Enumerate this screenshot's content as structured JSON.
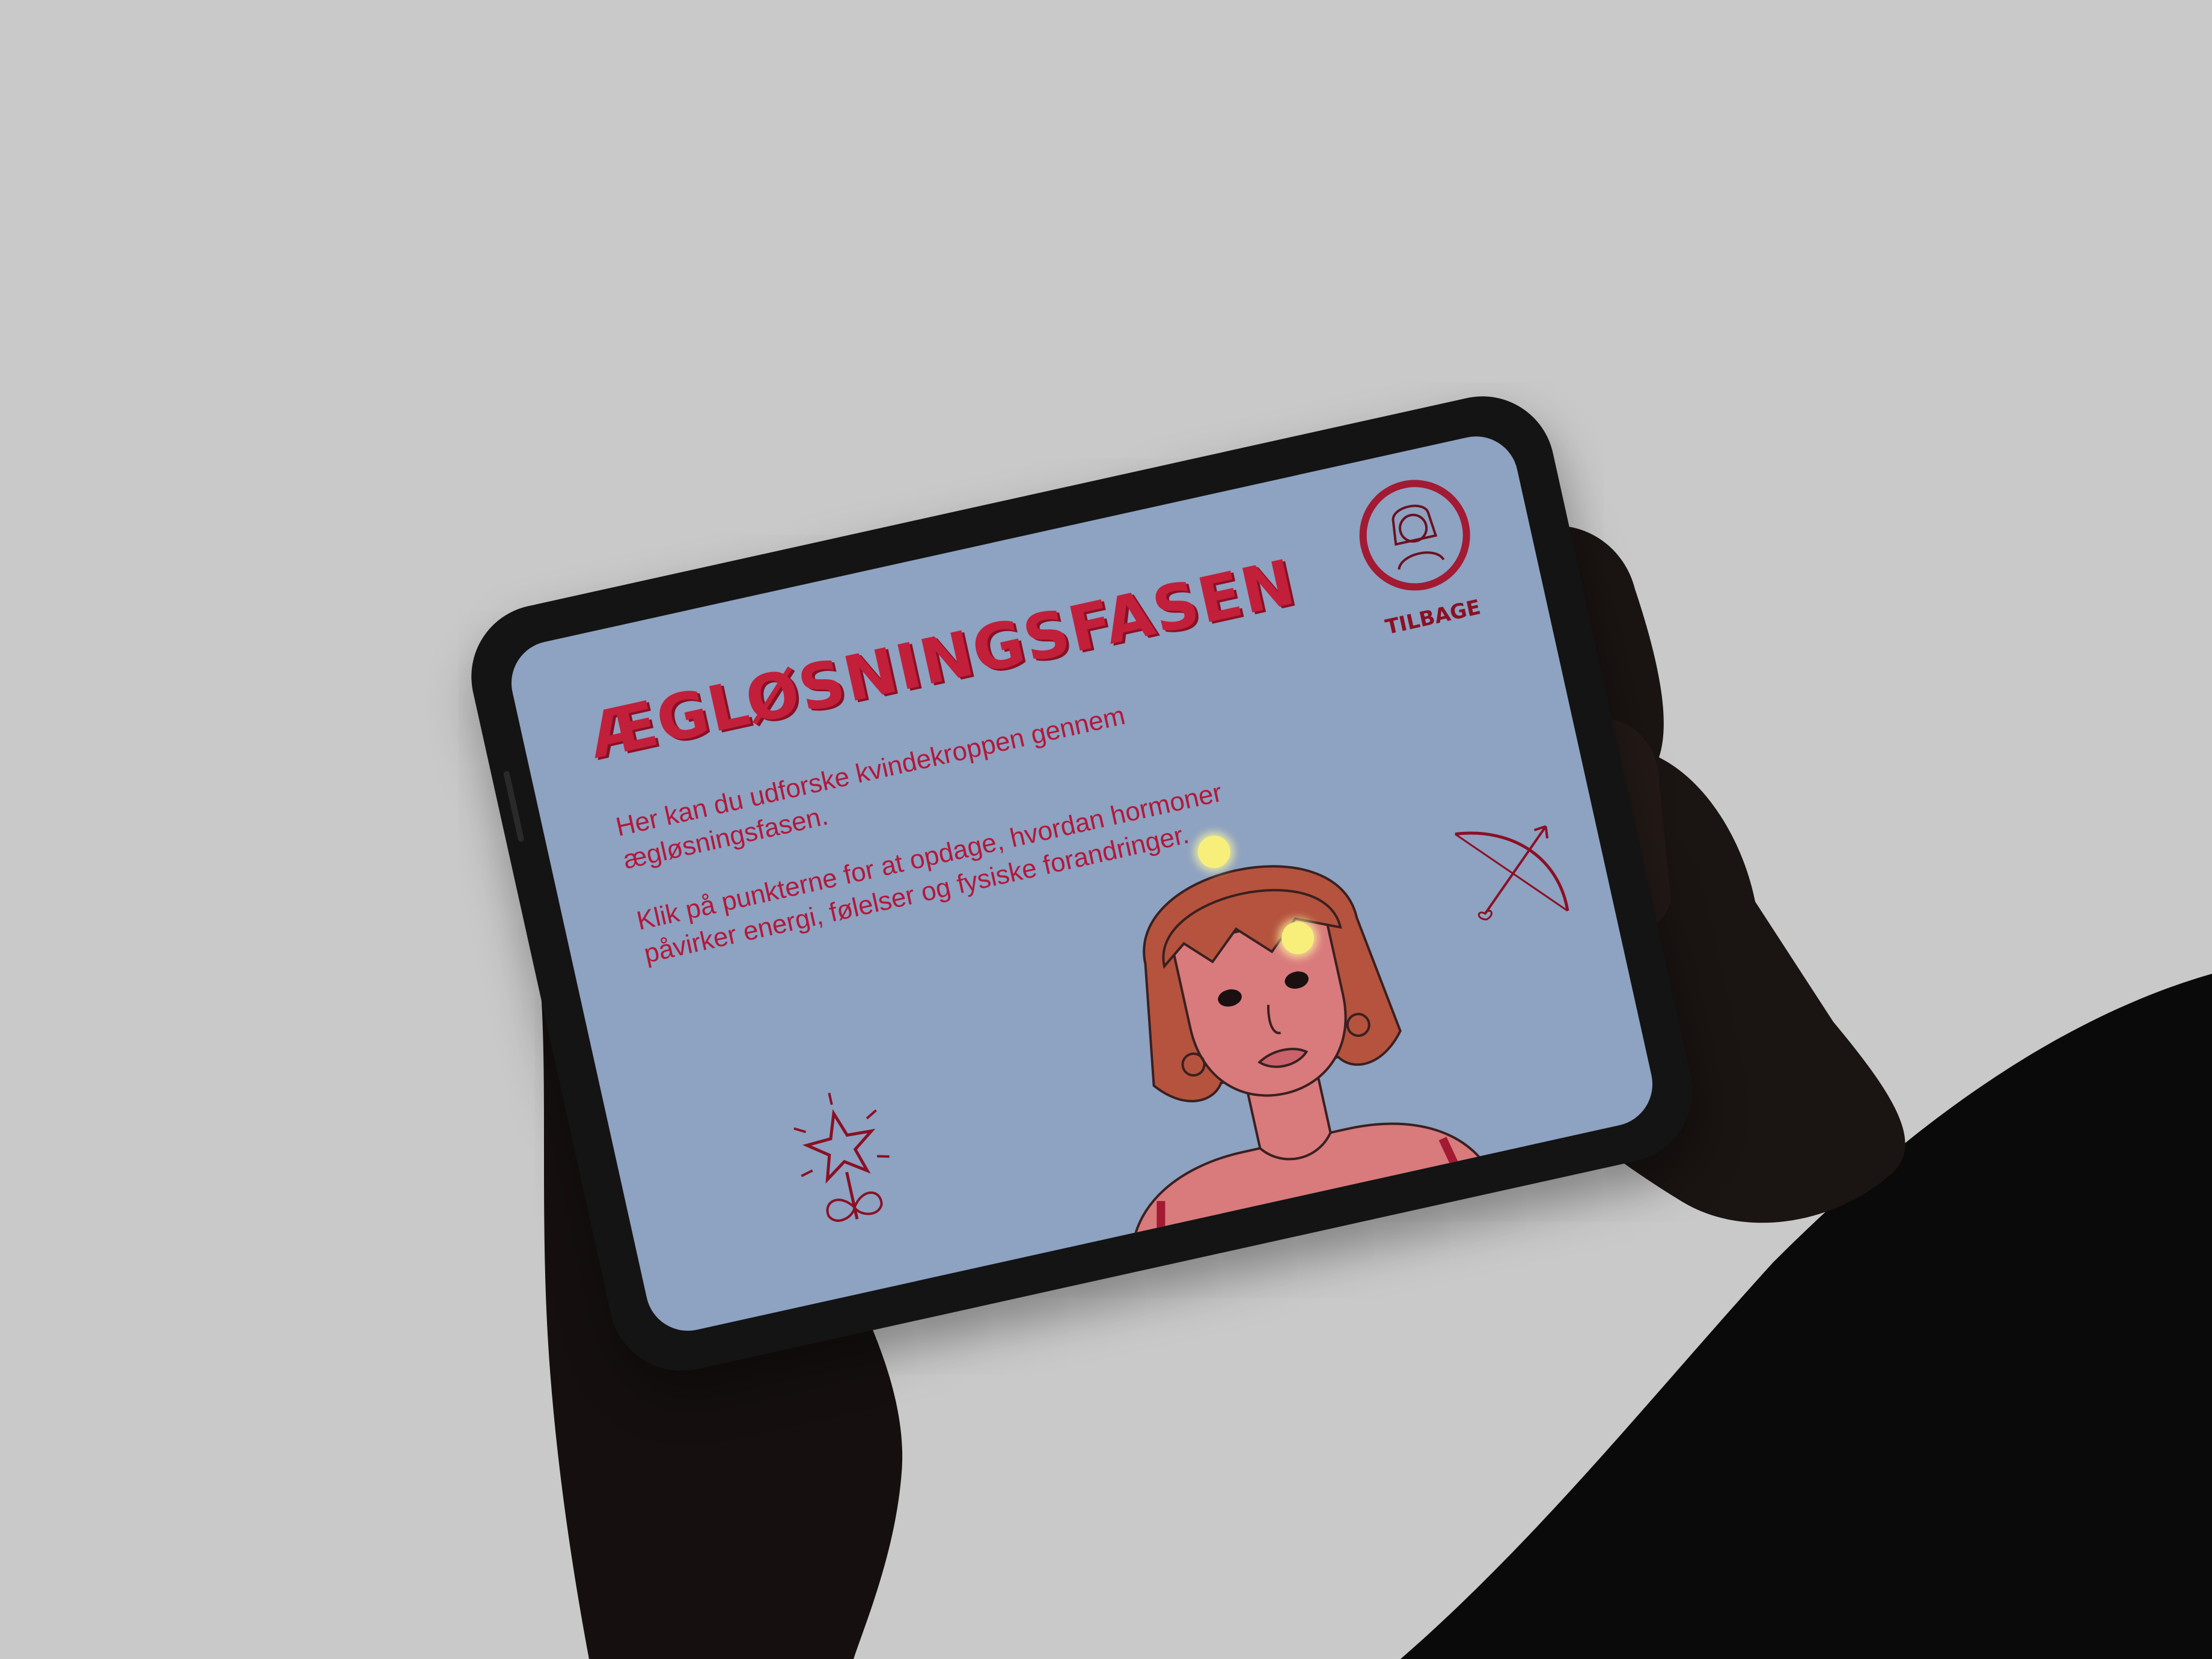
{
  "screen": {
    "title": "ÆGLØSNINGSFASEN",
    "intro": "Her kan du udforske kvindekroppen gennem ægløsningsfasen.",
    "instruction": "Klik på punkterne for at opdage, hvordan hormoner påvirker energi, følelser og fysiske forandringer.",
    "back_label": "TILBAGE"
  },
  "colors": {
    "background": "#c9c9c9",
    "screen_bg": "#8ea2c2",
    "accent": "#c21f3a",
    "hotspot": "#f7ef7a",
    "hair": "#b5533e",
    "skin": "#d97a7d"
  },
  "icons": [
    "back-avatar-icon",
    "bow-arrow-icon",
    "star-flower-icon"
  ]
}
